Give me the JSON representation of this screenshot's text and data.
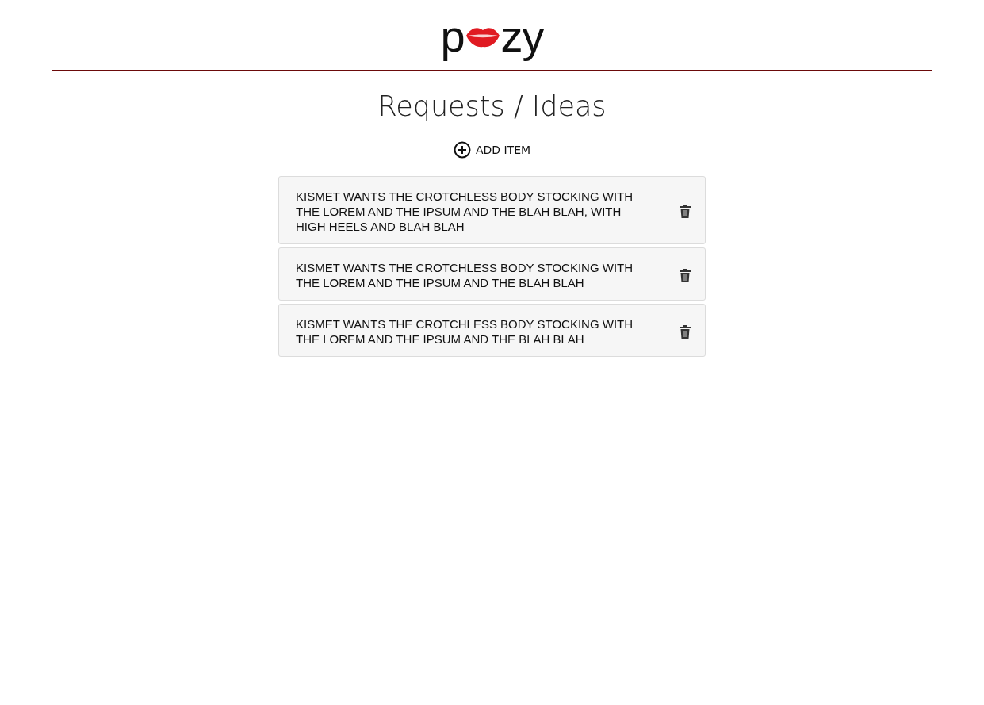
{
  "logo": {
    "before": "p",
    "after": "zy"
  },
  "title": "Requests / Ideas",
  "add_button": {
    "label": "ADD ITEM"
  },
  "items": [
    {
      "text": "KISMET WANTS THE CROTCHLESS BODY STOCKING WITH THE LOREM AND THE IPSUM AND THE BLAH BLAH, WITH HIGH HEELS AND BLAH BLAH"
    },
    {
      "text": "KISMET WANTS THE CROTCHLESS BODY STOCKING WITH THE LOREM AND THE IPSUM AND THE BLAH BLAH"
    },
    {
      "text": "KISMET WANTS THE CROTCHLESS BODY STOCKING WITH THE LOREM AND THE IPSUM AND THE BLAH BLAH"
    }
  ]
}
